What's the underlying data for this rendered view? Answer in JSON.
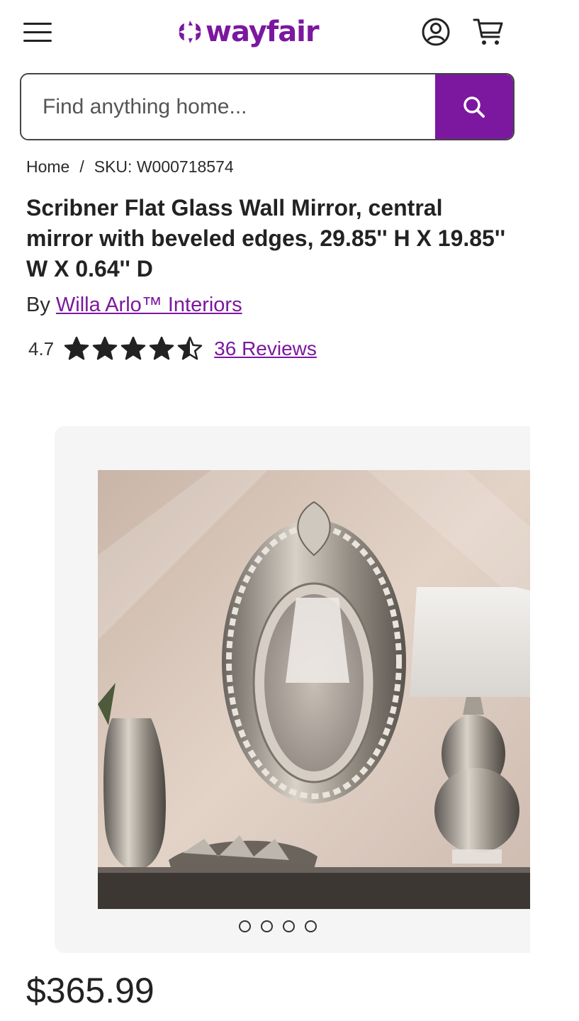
{
  "header": {
    "logo_text": "wayfair",
    "brand_color": "#7b189f"
  },
  "search": {
    "placeholder": "Find anything home..."
  },
  "breadcrumb": {
    "home": "Home",
    "separator": "/",
    "sku": "SKU: W000718574"
  },
  "product": {
    "title": "Scribner Flat Glass Wall Mirror, central mirror with beveled edges, 29.85'' H X 19.85'' W X 0.64'' D",
    "by_label": "By",
    "brand": "Willa Arlo™ Interiors",
    "rating": "4.7",
    "rating_stars": 4.7,
    "reviews": "36 Reviews",
    "price": "$365.99"
  },
  "carousel": {
    "image_count": 4,
    "active_index": 0
  },
  "icons": {
    "menu": "hamburger-menu-icon",
    "account": "account-icon",
    "cart": "cart-icon",
    "search": "search-icon",
    "star": "star-icon"
  }
}
